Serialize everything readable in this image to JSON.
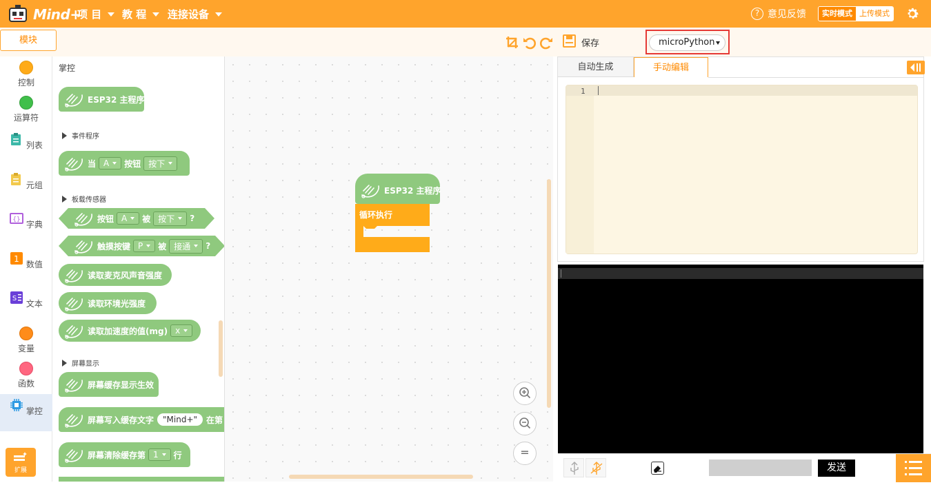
{
  "app": {
    "logo_text": "Mind+",
    "menus": [
      {
        "label": "项 目"
      },
      {
        "label": "教 程"
      },
      {
        "label": "连接设备"
      }
    ],
    "feedback_label": "意见反馈",
    "mode_realtime": "实时模式",
    "mode_upload": "上传模式",
    "accent_color": "#ffa42c"
  },
  "toolbar": {
    "module_tab": "模块",
    "save_label": "保存",
    "language": "microPython"
  },
  "categories": [
    {
      "label": "控制",
      "color": "#ffab19"
    },
    {
      "label": "运算符",
      "color": "#40bf4a"
    },
    {
      "label": "列表",
      "color": "#3cb8a8"
    },
    {
      "label": "元组",
      "color": "#f2c94c"
    },
    {
      "label": "字典",
      "color": "#b05fdc"
    },
    {
      "label": "数值",
      "color": "#ff8a00"
    },
    {
      "label": "文本",
      "color": "#6a3fd8"
    },
    {
      "label": "变量",
      "color": "#ff8c1a"
    },
    {
      "label": "函数",
      "color": "#ff6680"
    },
    {
      "label": "掌控",
      "color": "#2f9be3"
    }
  ],
  "extension_label": "扩展",
  "palette": {
    "title": "掌控",
    "main_block": "ESP32 主程序",
    "sections": {
      "events": "事件程序",
      "sensors": "板载传感器",
      "display": "屏幕显示"
    },
    "button_event": {
      "prefix": "当",
      "key": "A",
      "label": "按钮",
      "state": "按下"
    },
    "button_pressed": {
      "label": "按钮",
      "key": "A",
      "mid": "被",
      "state": "按下",
      "suffix": "?"
    },
    "touch_pressed": {
      "label": "触摸按键",
      "key": "P",
      "mid": "被",
      "state": "接通",
      "suffix": "?"
    },
    "mic": "读取麦克风声音强度",
    "light": "读取环境光强度",
    "accel": {
      "label": "读取加速度的值(mg)",
      "axis": "x"
    },
    "screen_show": "屏幕缓存显示生效",
    "screen_write": {
      "label": "屏幕写入缓存文字",
      "text": "\"Mind+\"",
      "suffix": "在第"
    },
    "screen_clear": {
      "label": "屏幕清除缓存第",
      "row": "1",
      "suffix": "行"
    }
  },
  "workspace": {
    "main_block": "ESP32 主程序",
    "loop_block": "循环执行",
    "zoom_in": "+",
    "zoom_out": "−",
    "zoom_reset": "="
  },
  "code": {
    "tab_auto": "自动生成",
    "tab_manual": "手动编辑",
    "line_number": "1"
  },
  "terminal": {
    "send_label": "发送"
  }
}
